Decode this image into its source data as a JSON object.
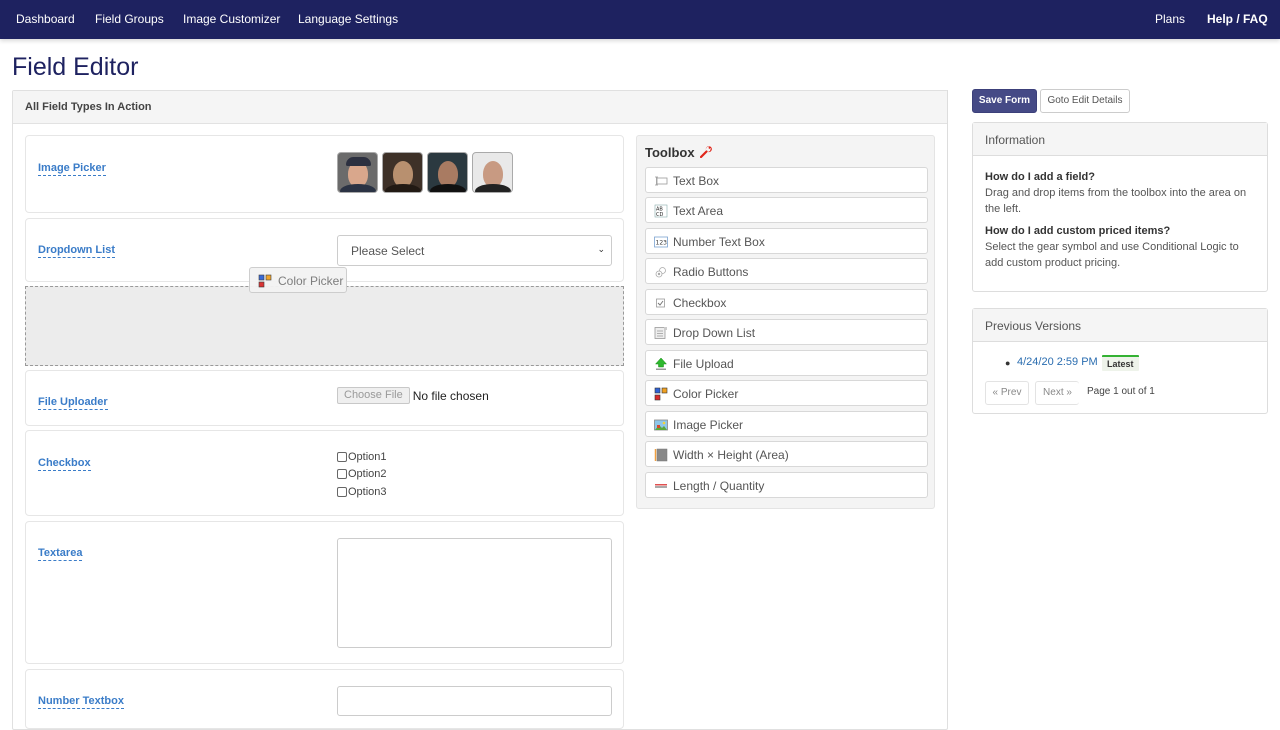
{
  "nav": {
    "left": [
      "Dashboard",
      "Field Groups",
      "Image Customizer",
      "Language Settings"
    ],
    "plans": "Plans",
    "help": "Help / FAQ"
  },
  "page_title": "Field Editor",
  "main_panel": {
    "heading": "All Field Types In Action",
    "fields": {
      "image_picker": {
        "label": "Image Picker",
        "images": [
          "portrait-1",
          "portrait-2",
          "portrait-3",
          "portrait-4"
        ]
      },
      "dropdown": {
        "label": "Dropdown List",
        "selected": "Please Select"
      },
      "drag_ghost": {
        "label": "Color Picker",
        "icon": "color-picker-icon"
      },
      "file_uploader": {
        "label": "File Uploader",
        "button": "Choose File",
        "status": "No file chosen"
      },
      "checkbox": {
        "label": "Checkbox",
        "options": [
          "Option1",
          "Option2",
          "Option3"
        ]
      },
      "textarea": {
        "label": "Textarea",
        "value": ""
      },
      "number_textbox": {
        "label": "Number Textbox",
        "value": ""
      }
    }
  },
  "toolbox": {
    "title": "Toolbox",
    "items": [
      {
        "label": "Text Box",
        "icon": "textbox-icon"
      },
      {
        "label": "Text Area",
        "icon": "textarea-icon"
      },
      {
        "label": "Number Text Box",
        "icon": "number-icon"
      },
      {
        "label": "Radio Buttons",
        "icon": "radio-icon"
      },
      {
        "label": "Checkbox",
        "icon": "checkbox-icon"
      },
      {
        "label": "Drop Down List",
        "icon": "dropdown-icon"
      },
      {
        "label": "File Upload",
        "icon": "upload-icon"
      },
      {
        "label": "Color Picker",
        "icon": "color-picker-icon"
      },
      {
        "label": "Image Picker",
        "icon": "image-icon"
      },
      {
        "label": "Width × Height (Area)",
        "icon": "area-icon"
      },
      {
        "label": "Length / Quantity",
        "icon": "length-icon"
      }
    ]
  },
  "actions": {
    "save": "Save Form",
    "goto": "Goto Edit Details"
  },
  "information": {
    "title": "Information",
    "q1": "How do I add a field?",
    "a1": "Drag and drop items from the toolbox into the area on the left.",
    "q2": "How do I add custom priced items?",
    "a2": "Select the gear symbol and use Conditional Logic to add custom product pricing."
  },
  "versions": {
    "title": "Previous Versions",
    "items": [
      {
        "date": "4/24/20 2:59 PM",
        "badge": "Latest"
      }
    ],
    "prev": "« Prev",
    "next": "Next »",
    "page_text": "Page 1 out of 1"
  },
  "colors": {
    "nav_bg": "#1e2260",
    "accent": "#454a86",
    "link": "#3a7cc8",
    "latest_badge": "#34b233"
  }
}
